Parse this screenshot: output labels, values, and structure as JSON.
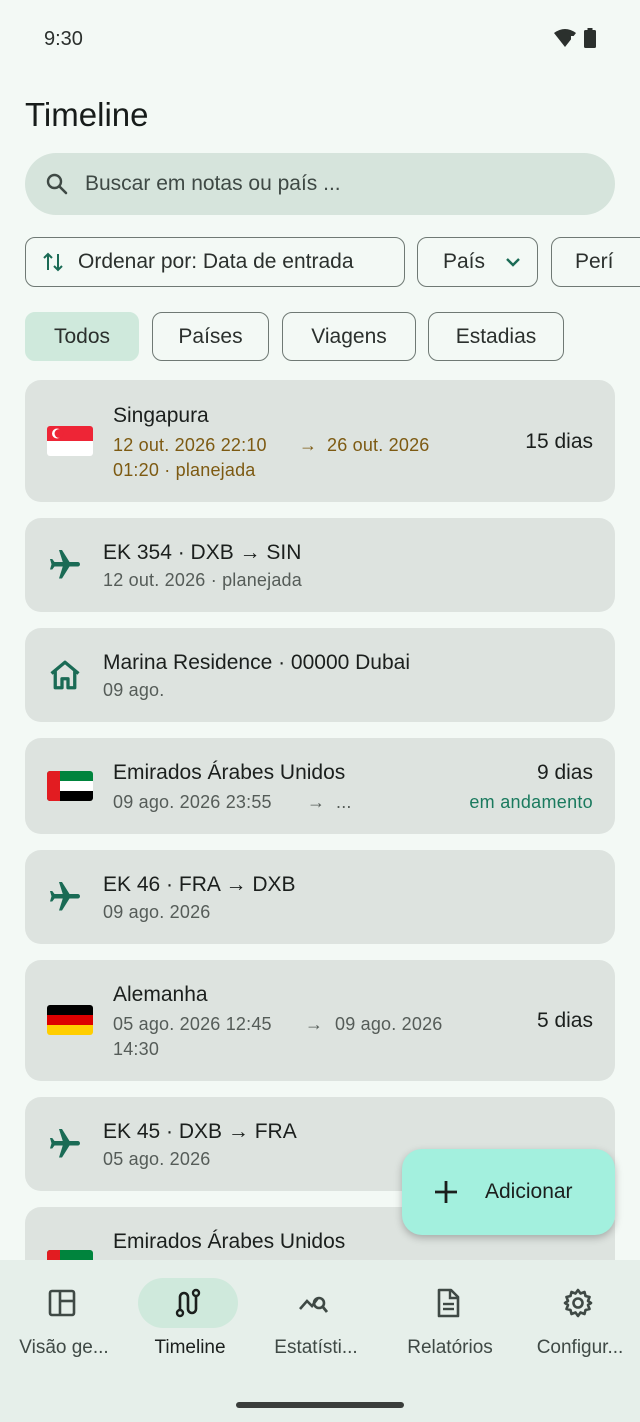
{
  "status_bar": {
    "time": "9:30",
    "wifi_icon": "wifi-icon",
    "battery_icon": "battery-icon"
  },
  "page": {
    "title": "Timeline"
  },
  "search": {
    "placeholder": "Buscar em notas ou país ..."
  },
  "sort_chips": {
    "sort_label": "Ordenar por: Data de entrada",
    "country_label": "País",
    "period_label": "Perí"
  },
  "filters": [
    {
      "label": "Todos",
      "active": true
    },
    {
      "label": "Países",
      "active": false
    },
    {
      "label": "Viagens",
      "active": false
    },
    {
      "label": "Estadias",
      "active": false
    }
  ],
  "timeline": [
    {
      "kind": "country",
      "flag": "singapore",
      "name": "Singapura",
      "line1": "12 out. 2026 22:10",
      "line1_end": "26 out. 2026",
      "line2": "01:20 · planejada",
      "duration": "15 dias"
    },
    {
      "kind": "flight",
      "name": "EK 354 · DXB → SIN",
      "sub": "12 out. 2026 · planejada"
    },
    {
      "kind": "stay",
      "name": "Marina Residence · 00000 Dubai",
      "sub": "09 ago."
    },
    {
      "kind": "country",
      "flag": "uae",
      "name": "Emirados Árabes Unidos",
      "line1": "09 ago. 2026 23:55",
      "line1_end": "...",
      "duration": "9 dias",
      "status": "em andamento"
    },
    {
      "kind": "flight",
      "name": "EK 46 · FRA → DXB",
      "sub": "09 ago. 2026"
    },
    {
      "kind": "country",
      "flag": "germany",
      "name": "Alemanha",
      "line1": "05 ago. 2026 12:45",
      "line1_end": "09 ago. 2026",
      "line2": "14:30",
      "duration": "5 dias"
    },
    {
      "kind": "flight",
      "name": "EK 45 · DXB → FRA",
      "sub": "05 ago. 2026"
    },
    {
      "kind": "country",
      "flag": "uae",
      "name": "Emirados Árabes Unidos"
    }
  ],
  "fab": {
    "label": "Adicionar",
    "icon": "plus-icon"
  },
  "nav": [
    {
      "label": "Visão ge...",
      "icon": "dashboard-icon",
      "active": false
    },
    {
      "label": "Timeline",
      "icon": "route-icon",
      "active": true
    },
    {
      "label": "Estatísti...",
      "icon": "query-stats-icon",
      "active": false
    },
    {
      "label": "Relatórios",
      "icon": "document-icon",
      "active": false
    },
    {
      "label": "Configur...",
      "icon": "gear-icon",
      "active": false
    }
  ],
  "colors": {
    "background": "#f3f9f5",
    "card": "#dde3df",
    "accent": "#1a6b55",
    "fab": "#a3f0de",
    "planned": "#7d5a12",
    "in_progress": "#1a7a5e"
  }
}
